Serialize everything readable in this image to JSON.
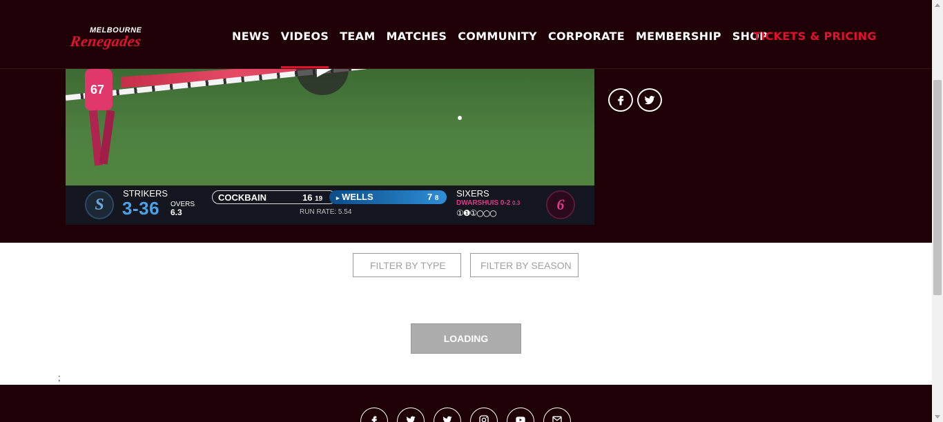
{
  "brand": {
    "logo_top": "MELBOURNE",
    "logo_main": "Renegades",
    "accent": "#e4112d",
    "dark": "#1f0007"
  },
  "nav": {
    "items": [
      {
        "label": "NEWS"
      },
      {
        "label": "VIDEOS",
        "active": true
      },
      {
        "label": "TEAM"
      },
      {
        "label": "MATCHES"
      },
      {
        "label": "COMMUNITY"
      },
      {
        "label": "CORPORATE"
      },
      {
        "label": "MEMBERSHIP"
      },
      {
        "label": "SHOP"
      }
    ],
    "cta": "TICKETS & PRICING"
  },
  "video": {
    "player_number": "67",
    "scoreboard": {
      "batting_team": "STRIKERS",
      "score": "3-36",
      "overs_label": "OVERS",
      "overs": "6.3",
      "batter1": {
        "name": "COCKBAIN",
        "runs": "16",
        "balls": "19"
      },
      "batter2": {
        "name": "WELLS",
        "runs": "7",
        "balls": "8",
        "marker": "▸"
      },
      "run_rate": "RUN RATE:  5.54",
      "bowling_team": "SIXERS",
      "bowler": "DWARSHUIS 0-2",
      "bowler_overs": "0.3",
      "balls_this_over": "①❶①○○○"
    }
  },
  "share": {
    "icons": [
      "facebook-icon",
      "twitter-icon"
    ]
  },
  "filters": {
    "type_label": "FILTER BY TYPE",
    "season_label": "FILTER BY SEASON"
  },
  "loading": {
    "label": "LOADING"
  },
  "stray_text": ";",
  "footer": {
    "social_icons": [
      "facebook-icon",
      "twitter-icon",
      "twitter-icon",
      "instagram-icon",
      "youtube-icon",
      "email-icon"
    ]
  }
}
